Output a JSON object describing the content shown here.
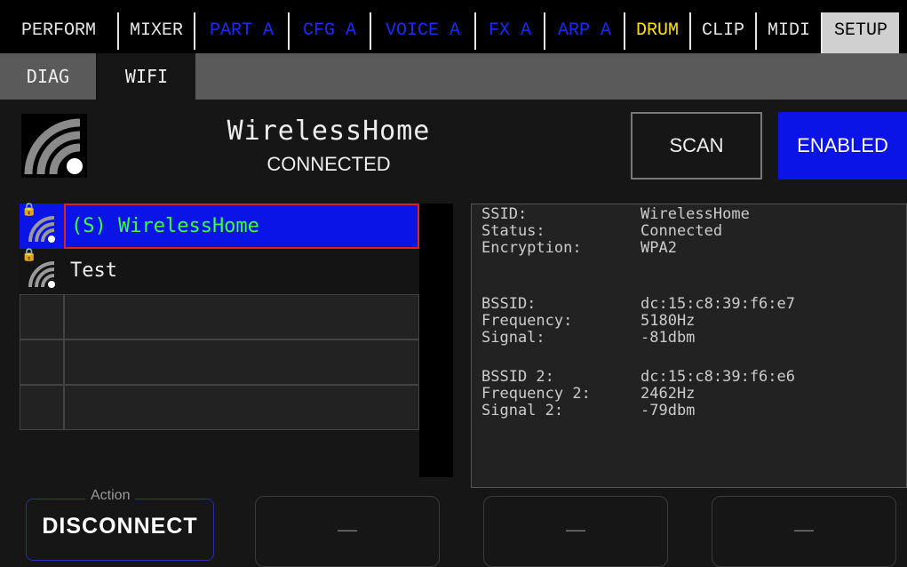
{
  "top_tabs": [
    {
      "label": "PERFORM",
      "color": "#e6e6e6"
    },
    {
      "label": "MIXER",
      "color": "#e6e6e6"
    },
    {
      "label": "PART A",
      "color": "#1a2bff"
    },
    {
      "label": "CFG A",
      "color": "#1a2bff"
    },
    {
      "label": "VOICE A",
      "color": "#1a2bff"
    },
    {
      "label": "FX A",
      "color": "#1a2bff"
    },
    {
      "label": "ARP A",
      "color": "#1a2bff"
    },
    {
      "label": "DRUM",
      "color": "#ffe000"
    },
    {
      "label": "CLIP",
      "color": "#e6e6e6"
    },
    {
      "label": "MIDI",
      "color": "#e6e6e6"
    },
    {
      "label": "SETUP",
      "color": "#000000",
      "active": true
    }
  ],
  "sub_tabs": [
    {
      "label": "DIAG",
      "active": false
    },
    {
      "label": "WIFI",
      "active": true
    }
  ],
  "header": {
    "ssid": "WirelessHome",
    "status": "CONNECTED",
    "scan_label": "SCAN",
    "enabled_label": "ENABLED"
  },
  "networks": [
    {
      "label": "(S) WirelessHome",
      "locked": true,
      "selected": true
    },
    {
      "label": "Test",
      "locked": true,
      "selected": false
    },
    {
      "label": "",
      "locked": false,
      "selected": false
    },
    {
      "label": "",
      "locked": false,
      "selected": false
    },
    {
      "label": "",
      "locked": false,
      "selected": false
    }
  ],
  "details": {
    "ssid_label": "SSID:",
    "ssid_value": "WirelessHome",
    "status_label": "Status:",
    "status_value": "Connected",
    "enc_label": "Encryption:",
    "enc_value": "WPA2",
    "bssid_label": "BSSID:",
    "bssid_value": "dc:15:c8:39:f6:e7",
    "freq_label": "Frequency:",
    "freq_value": "5180Hz",
    "signal_label": "Signal:",
    "signal_value": "-81dbm",
    "bssid2_label": "BSSID 2:",
    "bssid2_value": "dc:15:c8:39:f6:e6",
    "freq2_label": "Frequency 2:",
    "freq2_value": "2462Hz",
    "signal2_label": "Signal 2:",
    "signal2_value": "-79dbm"
  },
  "footer": {
    "action_label": "Action",
    "action_button": "DISCONNECT",
    "slot2": "—",
    "slot3": "—",
    "slot4": "—"
  },
  "icons": {
    "wifi": "wifi-icon",
    "lock": "lock-icon"
  },
  "colors": {
    "accent_blue": "#0a14e6",
    "selection_border": "#e02020",
    "selected_text": "#3cff3c",
    "drum_tab": "#ffe000",
    "lock": "#ffd000"
  }
}
